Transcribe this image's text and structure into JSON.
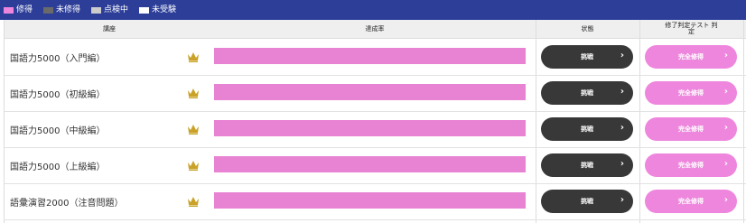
{
  "legend": [
    {
      "label": "修得",
      "color": "#ee86dd"
    },
    {
      "label": "未修得",
      "color": "#6a6a6a"
    },
    {
      "label": "点検中",
      "color": "#cccccc"
    },
    {
      "label": "未受験",
      "color": "#ffffff"
    }
  ],
  "table": {
    "headers": {
      "course": "講座",
      "progress": "達成率",
      "status": "状態",
      "test": "修了判定テスト 判定"
    },
    "rows": [
      {
        "course": "国語力5000（入門編）",
        "progress": 1.0,
        "challenge": "挑戦",
        "complete": "完全修得"
      },
      {
        "course": "国語力5000（初級編）",
        "progress": 1.0,
        "challenge": "挑戦",
        "complete": "完全修得"
      },
      {
        "course": "国語力5000（中級編）",
        "progress": 1.0,
        "challenge": "挑戦",
        "complete": "完全修得"
      },
      {
        "course": "国語力5000（上級編）",
        "progress": 1.0,
        "challenge": "挑戦",
        "complete": "完全修得"
      },
      {
        "course": "語彙演習2000（注音問題）",
        "progress": 1.0,
        "challenge": "挑戦",
        "complete": "完全修得"
      }
    ]
  },
  "colors": {
    "header_bar": "#2c3e98",
    "progress_fill": "#e882d3",
    "challenge_button": "#383838",
    "complete_button": "#ee86dd",
    "crown": "#c9a227"
  },
  "icons": {
    "crown": "crown-icon",
    "arrow": "chevron-right-icon"
  }
}
